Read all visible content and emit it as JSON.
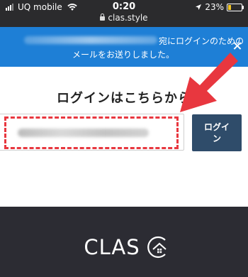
{
  "status_bar": {
    "carrier": "UQ mobile",
    "time": "0:20",
    "battery": "23%",
    "battery_level": 0.23,
    "url": "clas.style"
  },
  "banner": {
    "message_line1": "宛にログインのための",
    "message_line2": "メールをお送りしました。",
    "accent": "#1e7fd6"
  },
  "login": {
    "heading": "ログインはこちらから",
    "email_value": "",
    "button_label": "ログイン\nン"
  },
  "annotation": {
    "highlight_color": "#e8373f"
  },
  "footer": {
    "logo_text": "CLAS",
    "background": "#2c2c33"
  }
}
